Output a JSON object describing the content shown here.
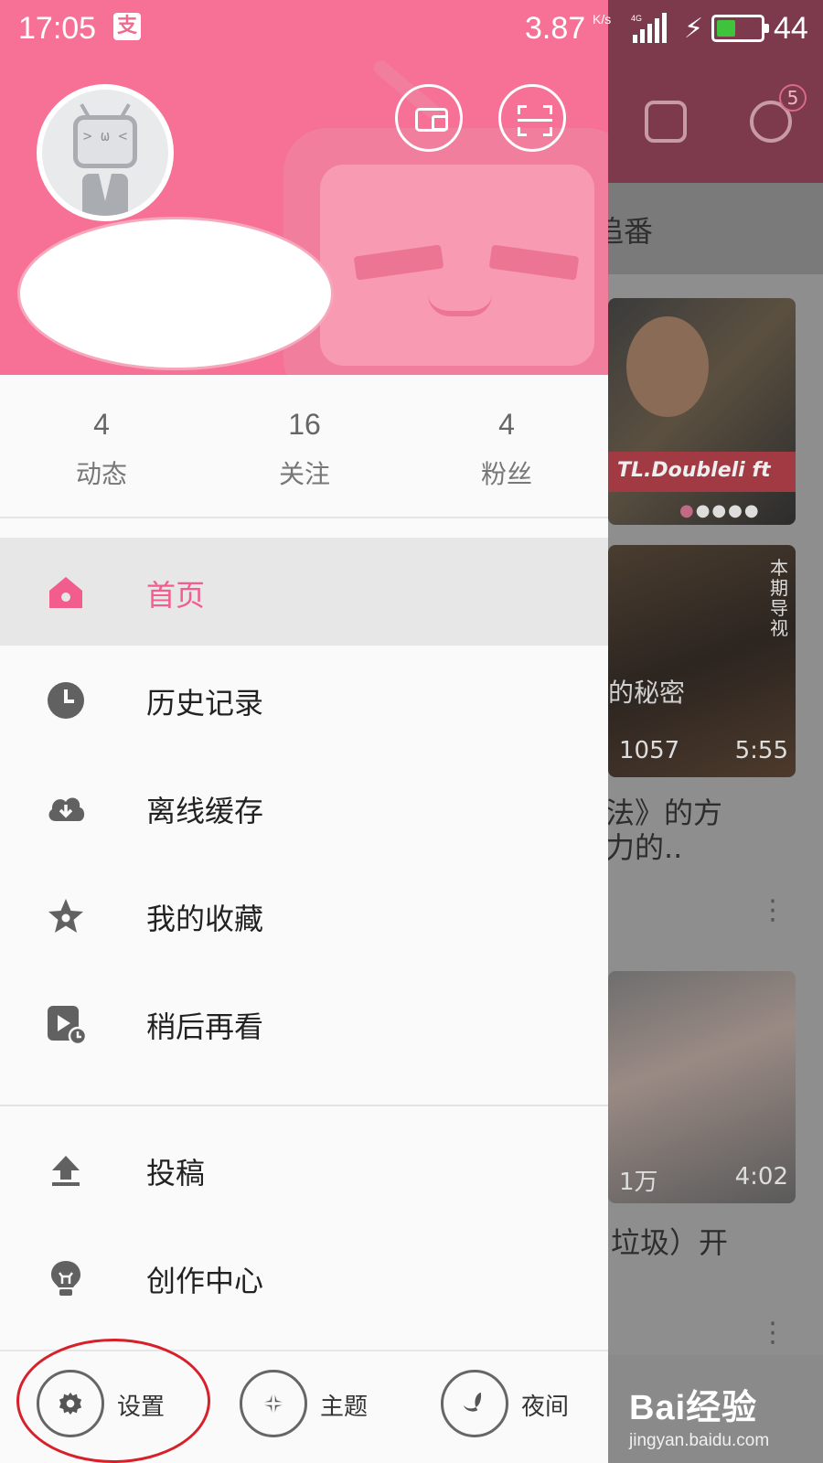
{
  "status_bar": {
    "time": "17:05",
    "app_icon_glyph": "支",
    "net_speed": "3.87",
    "net_speed_unit": "K/s",
    "network_type": "4G",
    "battery_level": "44",
    "battery_fraction": 0.44
  },
  "background_app": {
    "tab_fragment": "追番",
    "message_badge": "5",
    "banner_text": "TL.Doubleli ft",
    "card2_side_text": "本期导视",
    "card2_overlay_text": "的秘密",
    "card2_views": "1057",
    "card2_duration": "5:55",
    "card2_title_line1": "法》的方",
    "card2_title_line2": "力的..",
    "card3_views": "1万",
    "card3_duration": "4:02",
    "card3_title": "垃圾）开"
  },
  "profile": {
    "avatar_icon": "bilibili-tv-avatar"
  },
  "stats": {
    "dynamic": {
      "count": "4",
      "label": "动态"
    },
    "follow": {
      "count": "16",
      "label": "关注"
    },
    "fans": {
      "count": "4",
      "label": "粉丝"
    }
  },
  "menu": {
    "items": [
      {
        "label": "首页",
        "icon": "home-icon",
        "active": true
      },
      {
        "label": "历史记录",
        "icon": "clock-icon"
      },
      {
        "label": "离线缓存",
        "icon": "cloud-download-icon"
      },
      {
        "label": "我的收藏",
        "icon": "star-icon"
      },
      {
        "label": "稍后再看",
        "icon": "play-later-icon"
      },
      {
        "label": "投稿",
        "icon": "upload-icon"
      },
      {
        "label": "创作中心",
        "icon": "bulb-icon"
      }
    ]
  },
  "footer": {
    "settings_label": "设置",
    "theme_label": "主题",
    "night_label": "夜间"
  },
  "watermark": {
    "logo": "Bai经验",
    "url": "jingyan.baidu.com"
  },
  "colors": {
    "accent": "#f25d8e",
    "header_pink": "#f67195",
    "highlight_circle": "#d8202a"
  }
}
